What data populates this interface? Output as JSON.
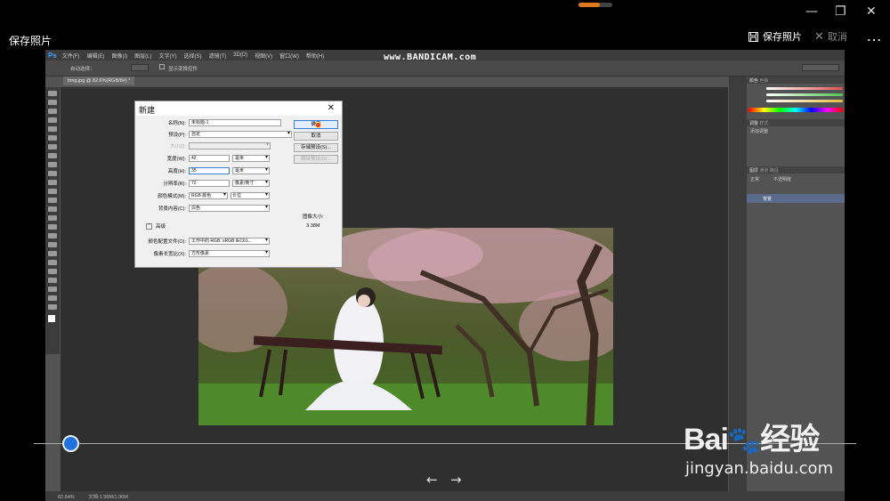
{
  "window": {
    "progress": 0.62,
    "minimize_glyph": "—",
    "restore_glyph": "❐",
    "close_glyph": "✕"
  },
  "viewer": {
    "title": "保存照片",
    "save_label": "保存照片",
    "cancel_label": "取消",
    "more_glyph": "…",
    "prev_glyph": "←",
    "next_glyph": "→",
    "seek_position": 0.04
  },
  "watermarks": {
    "recorder": "www.BANDICAM.com",
    "brand_text": "Bai",
    "brand_text2": "经验",
    "url": "jingyan.baidu.com"
  },
  "photoshop": {
    "logo": "Ps",
    "menus": [
      "文件(F)",
      "编辑(E)",
      "图像(I)",
      "图层(L)",
      "文字(Y)",
      "选择(S)",
      "滤镜(T)",
      "3D(D)",
      "视图(V)",
      "窗口(W)",
      "帮助(H)"
    ],
    "options_text": "自动选择：",
    "options_text2": "显示变换控件",
    "doc_tab": "timg.jpg @ 82.6%(RGB/8#) *",
    "status_zoom": "82.64%",
    "status_doc": "文档:1.96M/1.96M",
    "panel_color_tab": "颜色",
    "panel_swatch_tab": "色板",
    "panel_adjust_tab": "调整",
    "panel_style_tab": "样式",
    "panel_adjust_hint": "添加调整",
    "panel_layers_tab": "图层",
    "panel_channels_tab": "通道",
    "panel_paths_tab": "路径",
    "layer_blend": "正常",
    "layer_opacity": "不透明度",
    "layer_name": "背景",
    "colors": {
      "accent": "#3aa0ff",
      "slider_r": "#e05050",
      "slider_g": "#50c050",
      "slider_b": "#e0c040"
    }
  },
  "dialog": {
    "title": "新建",
    "close_glyph": "✕",
    "name_label": "名称(N):",
    "name_value": "未标题-1",
    "preset_label": "预设(P):",
    "preset_value": "自定",
    "size_label": "大小(I):",
    "width_label": "宽度(W):",
    "width_value": "42",
    "width_unit": "毫米",
    "height_label": "高度(H):",
    "height_value": "35",
    "height_unit": "毫米",
    "resolution_label": "分辨率(R):",
    "resolution_value": "72",
    "resolution_unit": "像素/英寸",
    "colormode_label": "颜色模式(M):",
    "colormode_value": "RGB 颜色",
    "bitdepth_value": "8 位",
    "background_label": "背景内容(C):",
    "background_value": "白色",
    "advanced_label": "高级",
    "profile_label": "颜色配置文件(O):",
    "profile_value": "工作中的 RGB: sRGB IEC61...",
    "pixel_aspect_label": "像素长宽比(X):",
    "pixel_aspect_value": "方形像素",
    "ok_label": "确定",
    "cancel_label": "取消",
    "save_preset_label": "存储预设(S)...",
    "delete_preset_label": "删除预设(D)...",
    "image_size_label": "图像大小:",
    "image_size_value": "3.38M"
  }
}
